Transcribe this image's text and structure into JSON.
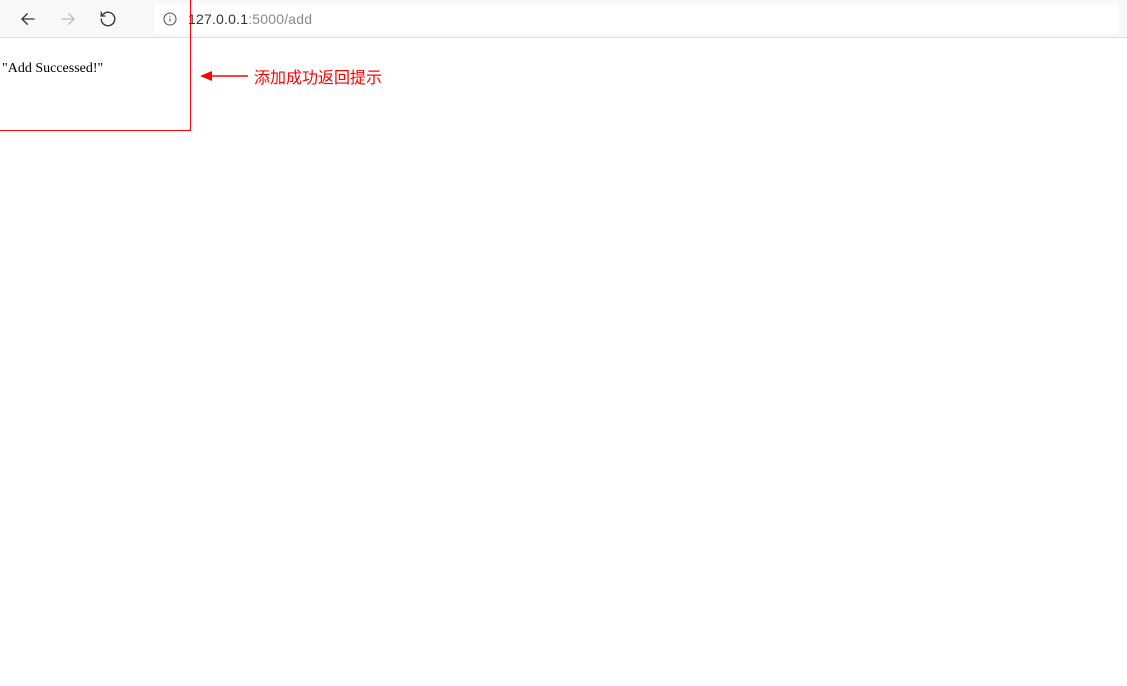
{
  "browser": {
    "url_host": "127.0.0.1",
    "url_path": ":5000/add"
  },
  "page": {
    "response_text": "\"Add Successed!\""
  },
  "annotation": {
    "label": "添加成功返回提示"
  }
}
